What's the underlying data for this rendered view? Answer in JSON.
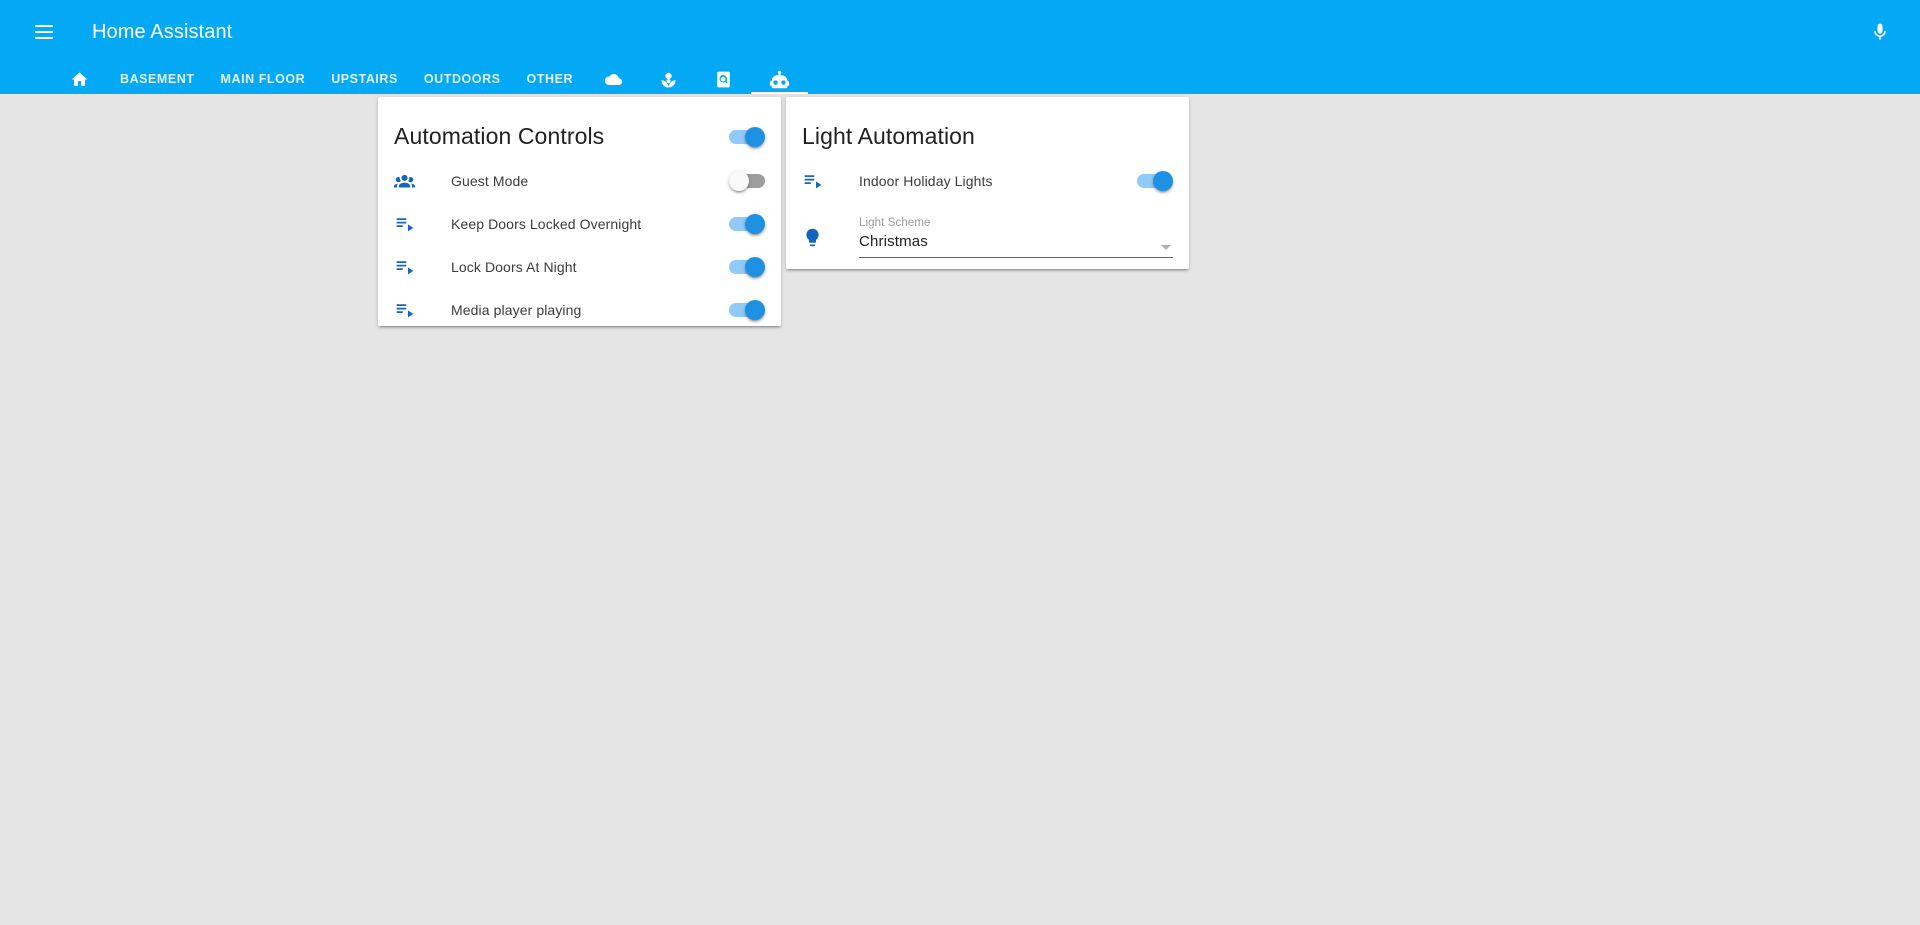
{
  "app": {
    "title": "Home Assistant",
    "menu_icon": "hamburger-menu-icon",
    "mic_icon": "microphone-icon",
    "accent_color": "#03a9f4",
    "background_color": "#e5e5e5",
    "toggle_on_color": "#1e91e2",
    "toggle_on_track_color": "#90caf9",
    "toggle_off_track_color": "#9e9e9e",
    "icon_color": "#1565c0"
  },
  "tabs": [
    {
      "type": "icon",
      "icon": "home-icon",
      "label": "",
      "active": false
    },
    {
      "type": "text",
      "icon": "",
      "label": "BASEMENT",
      "active": false
    },
    {
      "type": "text",
      "icon": "",
      "label": "MAIN FLOOR",
      "active": false
    },
    {
      "type": "text",
      "icon": "",
      "label": "UPSTAIRS",
      "active": false
    },
    {
      "type": "text",
      "icon": "",
      "label": "OUTDOORS",
      "active": false
    },
    {
      "type": "text",
      "icon": "",
      "label": "OTHER",
      "active": false
    },
    {
      "type": "icon",
      "icon": "cloud-icon",
      "label": "",
      "active": false
    },
    {
      "type": "icon",
      "icon": "flower-icon",
      "label": "",
      "active": false
    },
    {
      "type": "icon",
      "icon": "harddisk-icon",
      "label": "",
      "active": false
    },
    {
      "type": "icon",
      "icon": "robot-icon",
      "label": "",
      "active": true
    }
  ],
  "cards": [
    {
      "id": "automation-controls",
      "title": "Automation Controls",
      "header_toggle": {
        "state": "on",
        "name": "automation-controls-master-toggle"
      },
      "rows": [
        {
          "icon": "account-group-icon",
          "label": "Guest Mode",
          "toggle": "off"
        },
        {
          "icon": "playlist-play-icon",
          "label": "Keep Doors Locked Overnight",
          "toggle": "on"
        },
        {
          "icon": "playlist-play-icon",
          "label": "Lock Doors At Night",
          "toggle": "on"
        },
        {
          "icon": "playlist-play-icon",
          "label": "Media player playing",
          "toggle": "on"
        }
      ]
    },
    {
      "id": "light-automation",
      "title": "Light Automation",
      "header_toggle": null,
      "rows": [
        {
          "icon": "playlist-play-icon",
          "label": "Indoor Holiday Lights",
          "toggle": "on"
        }
      ],
      "select": {
        "icon": "lightbulb-icon",
        "label": "Light Scheme",
        "value": "Christmas",
        "options": [
          "Christmas"
        ]
      }
    }
  ]
}
